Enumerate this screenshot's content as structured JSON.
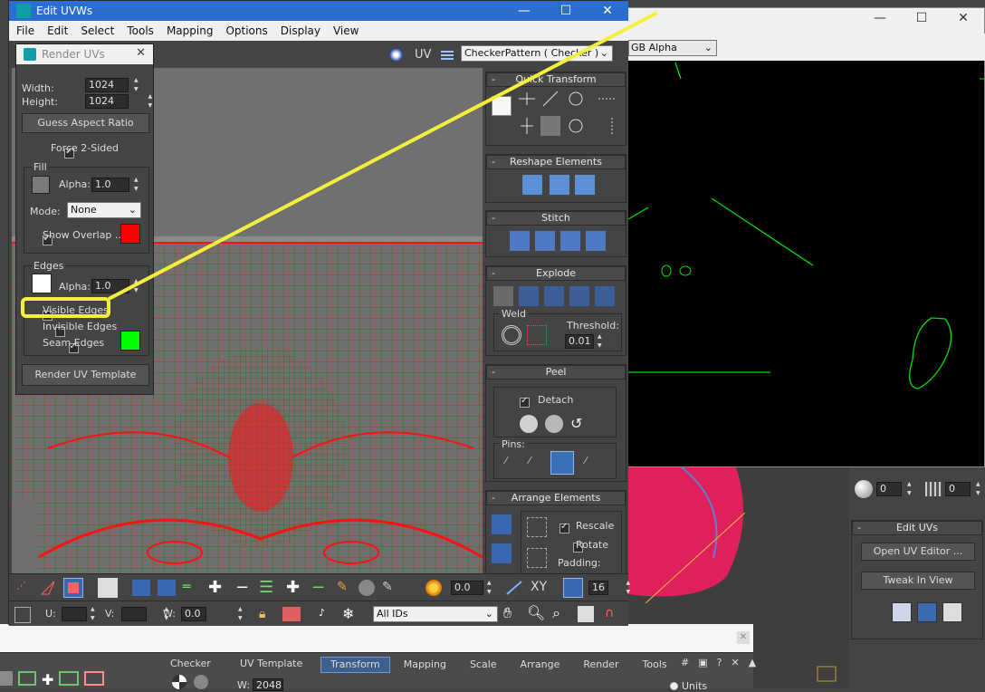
{
  "main_window": {
    "title": "Edit UVWs",
    "menu": [
      "File",
      "Edit",
      "Select",
      "Tools",
      "Mapping",
      "Options",
      "Display",
      "View"
    ],
    "uv_label": "UV",
    "texture_dropdown": "CheckerPattern  ( Checker )"
  },
  "render_uvs": {
    "title": "Render UVs",
    "width_label": "Width:",
    "width_value": "1024",
    "height_label": "Height:",
    "height_value": "1024",
    "guess_aspect": "Guess Aspect Ratio",
    "force_2sided": "Force 2-Sided",
    "fill_group": "Fill",
    "fill_alpha_label": "Alpha:",
    "fill_alpha_value": "1.0",
    "mode_label": "Mode:",
    "mode_value": "None",
    "show_overlap": "Show Overlap ...",
    "edges_group": "Edges",
    "edges_alpha_label": "Alpha:",
    "edges_alpha_value": "1.0",
    "visible_edges": "Visible Edges",
    "invisible_edges": "Invisible Edges",
    "seam_edges": "Seam Edges",
    "render_template": "Render UV Template",
    "colors": {
      "fill": "#7a7a7a",
      "overlap": "#ff0000",
      "edges": "#ffffff",
      "seam": "#00ff00"
    }
  },
  "right_panel": {
    "quick_transform": "Quick Transform",
    "reshape_elements": "Reshape Elements",
    "stitch": "Stitch",
    "explode": "Explode",
    "weld_group": "Weld",
    "threshold_label": "Threshold:",
    "threshold_value": "0.01",
    "peel": "Peel",
    "detach": "Detach",
    "pins_label": "Pins:",
    "arrange_elements": "Arrange Elements",
    "rescale": "Rescale",
    "rotate": "Rotate",
    "padding_label": "Padding:"
  },
  "bottom_toolbar": {
    "value_a": "0.0",
    "xy_label": "XY",
    "value_16": "16",
    "u_label": "U:",
    "v_label": "V:",
    "w_label": "W:",
    "w_value": "0.0",
    "ids_dropdown": "All IDs"
  },
  "render_window": {
    "channel_dropdown": "GB Alpha"
  },
  "max_right_panel": {
    "spinner_a": "0",
    "spinner_b": "0",
    "edit_uvs": "Edit UVs",
    "open_uv_editor": "Open UV Editor ...",
    "tweak_in_view": "Tweak In View"
  },
  "bottom_strip": {
    "checker_label": "Checker",
    "uv_template_label": "UV Template",
    "w_label": "W:",
    "w_value": "2048",
    "tabs": [
      "Transform",
      "Mapping",
      "Scale",
      "Arrange",
      "Render",
      "Tools"
    ],
    "units_label": "Units"
  }
}
